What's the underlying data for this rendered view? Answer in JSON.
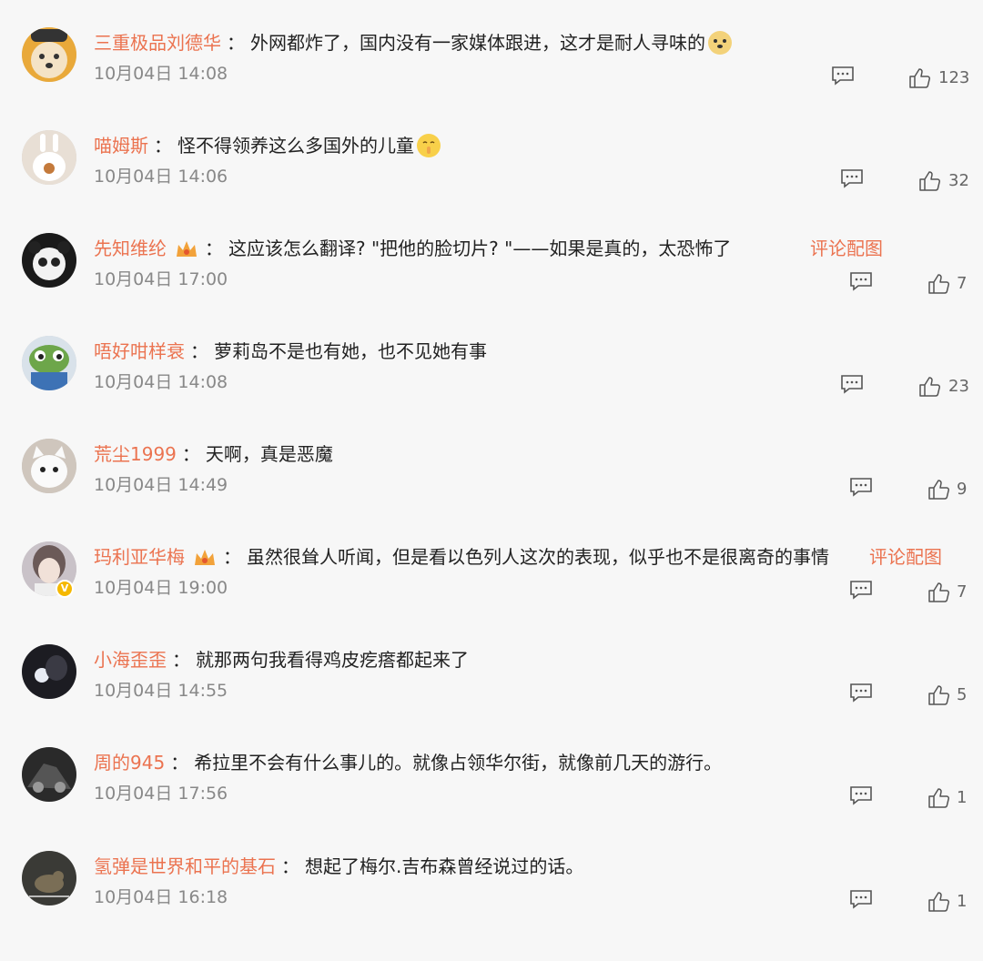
{
  "comments": [
    {
      "username": "三重极品刘德华",
      "content": "外网都炸了，国内没有一家媒体跟进，这才是耐人寻味的",
      "time": "10月04日 14:08",
      "likes": "123",
      "emoji": "doge",
      "avatar": "dog"
    },
    {
      "username": "喵姆斯",
      "content": "怪不得领养这么多国外的儿童",
      "time": "10月04日 14:06",
      "likes": "32",
      "emoji": "shush",
      "avatar": "bunny"
    },
    {
      "username": "先知维纶",
      "content": "这应该怎么翻译? \"把他的脸切片? \"——如果是真的，太恐怖了",
      "time": "10月04日 17:00",
      "likes": "7",
      "image_comment": "评论配图",
      "avatar": "panda"
    },
    {
      "username": "唔好咁样衰",
      "content": "萝莉岛不是也有她，也不见她有事",
      "time": "10月04日 14:08",
      "likes": "23",
      "avatar": "frog"
    },
    {
      "username": "荒尘1999",
      "content": "天啊，真是恶魔",
      "time": "10月04日 14:49",
      "likes": "9",
      "avatar": "cat"
    },
    {
      "username": "玛利亚华梅",
      "content": "虽然很耸人听闻，但是看以色列人这次的表现，似乎也不是很离奇的事情",
      "time": "10月04日 19:00",
      "likes": "7",
      "image_comment": "评论配图",
      "avatar": "girl",
      "verified": "V"
    },
    {
      "username": "小海歪歪",
      "content": "就那两句我看得鸡皮疙瘩都起来了",
      "time": "10月04日 14:55",
      "likes": "5",
      "avatar": "dark"
    },
    {
      "username": "周的945",
      "content": "希拉里不会有什么事儿的。就像占领华尔街，就像前几天的游行。",
      "time": "10月04日 17:56",
      "likes": "1",
      "avatar": "car"
    },
    {
      "username": "氢弹是世界和平的基石",
      "content": "想起了梅尔.吉布森曾经说过的话。",
      "time": "10月04日 16:18",
      "likes": "1",
      "avatar": "bird"
    }
  ],
  "separator": "："
}
